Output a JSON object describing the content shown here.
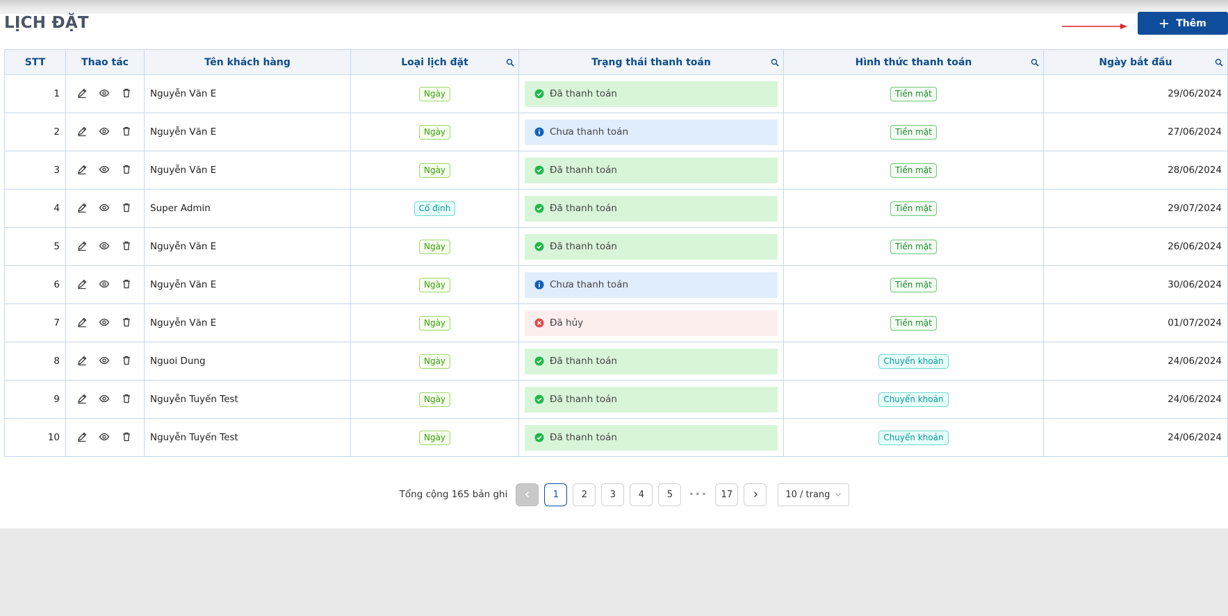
{
  "page": {
    "title": "LỊCH ĐẶT",
    "add_label": "Thêm"
  },
  "columns": {
    "stt": "STT",
    "actions": "Thao tác",
    "customer": "Tên khách hàng",
    "booking_type": "Loại lịch đặt",
    "payment_status": "Trạng thái thanh toán",
    "payment_method": "Hình thức thanh toán",
    "start_date": "Ngày bắt đầu"
  },
  "rows": [
    {
      "stt": "1",
      "customer": "Nguyễn Văn E",
      "type": "Ngày",
      "type_kind": "day",
      "status": "Đã thanh toán",
      "status_kind": "paid",
      "method": "Tiền mặt",
      "date": "29/06/2024"
    },
    {
      "stt": "2",
      "customer": "Nguyễn Văn E",
      "type": "Ngày",
      "type_kind": "day",
      "status": "Chưa thanh toán",
      "status_kind": "unpaid",
      "method": "Tiền mặt",
      "date": "27/06/2024"
    },
    {
      "stt": "3",
      "customer": "Nguyễn Văn E",
      "type": "Ngày",
      "type_kind": "day",
      "status": "Đã thanh toán",
      "status_kind": "paid",
      "method": "Tiền mặt",
      "date": "28/06/2024"
    },
    {
      "stt": "4",
      "customer": "Super Admin",
      "type": "Cố định",
      "type_kind": "fixed",
      "status": "Đã thanh toán",
      "status_kind": "paid",
      "method": "Tiền mặt",
      "date": "29/07/2024"
    },
    {
      "stt": "5",
      "customer": "Nguyễn Văn E",
      "type": "Ngày",
      "type_kind": "day",
      "status": "Đã thanh toán",
      "status_kind": "paid",
      "method": "Tiền mặt",
      "date": "26/06/2024"
    },
    {
      "stt": "6",
      "customer": "Nguyễn Văn E",
      "type": "Ngày",
      "type_kind": "day",
      "status": "Chưa thanh toán",
      "status_kind": "unpaid",
      "method": "Tiền mặt",
      "date": "30/06/2024"
    },
    {
      "stt": "7",
      "customer": "Nguyễn Văn E",
      "type": "Ngày",
      "type_kind": "day",
      "status": "Đã hủy",
      "status_kind": "cancelled",
      "method": "Tiền mặt",
      "date": "01/07/2024"
    },
    {
      "stt": "8",
      "customer": "Nguoi Dung",
      "type": "Ngày",
      "type_kind": "day",
      "status": "Đã thanh toán",
      "status_kind": "paid",
      "method": "Chuyển khoản",
      "date": "24/06/2024"
    },
    {
      "stt": "9",
      "customer": "Nguyễn Tuyến Test",
      "type": "Ngày",
      "type_kind": "day",
      "status": "Đã thanh toán",
      "status_kind": "paid",
      "method": "Chuyển khoản",
      "date": "24/06/2024"
    },
    {
      "stt": "10",
      "customer": "Nguyễn Tuyến Test",
      "type": "Ngày",
      "type_kind": "day",
      "status": "Đã thanh toán",
      "status_kind": "paid",
      "method": "Chuyển khoản",
      "date": "24/06/2024"
    }
  ],
  "pagination": {
    "total_label": "Tổng cộng 165 bản ghi",
    "pages": [
      "1",
      "2",
      "3",
      "4",
      "5"
    ],
    "dots": "•••",
    "last_page": "17",
    "current": "1",
    "page_size_label": "10 / trang"
  },
  "colors": {
    "primary": "#0d4d9a",
    "paid": "#1fb84b",
    "unpaid": "#1160b8",
    "cancelled": "#e5484d",
    "arrow": "#e0242b"
  }
}
